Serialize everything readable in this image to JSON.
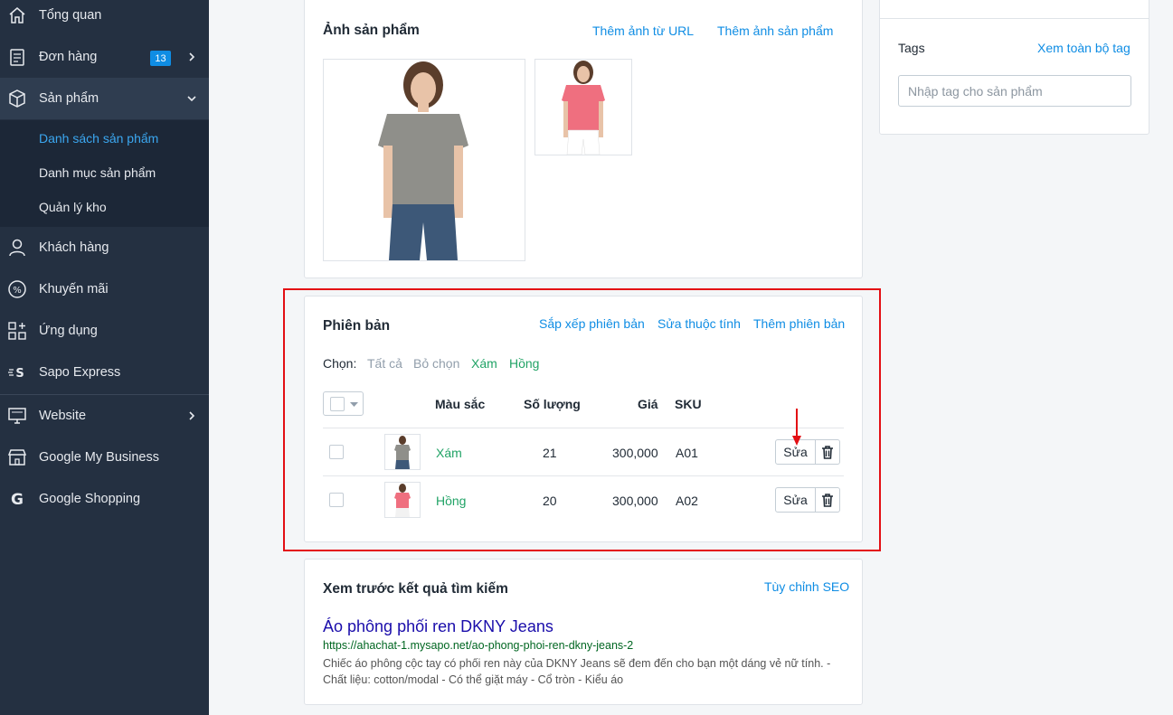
{
  "sidebar": {
    "items": [
      {
        "label": "Tổng quan",
        "icon": "home-icon"
      },
      {
        "label": "Đơn hàng",
        "icon": "orders-icon",
        "badge": "13"
      },
      {
        "label": "Sản phẩm",
        "icon": "box-icon"
      },
      {
        "label": "Khách hàng",
        "icon": "user-icon"
      },
      {
        "label": "Khuyến mãi",
        "icon": "percent-icon"
      },
      {
        "label": "Ứng dụng",
        "icon": "apps-icon"
      },
      {
        "label": "Sapo Express",
        "icon": "express-icon"
      },
      {
        "label": "Website",
        "icon": "monitor-icon"
      },
      {
        "label": "Google My Business",
        "icon": "store-icon"
      },
      {
        "label": "Google Shopping",
        "icon": "google-icon"
      }
    ],
    "submenu": [
      "Danh sách sản phẩm",
      "Danh mục sản phẩm",
      "Quản lý kho"
    ]
  },
  "images_card": {
    "title": "Ảnh sản phẩm",
    "add_from_url": "Thêm ảnh từ URL",
    "add_image": "Thêm ảnh sản phẩm"
  },
  "variants_card": {
    "title": "Phiên bản",
    "sort_link": "Sắp xếp phiên bản",
    "edit_attr_link": "Sửa thuộc tính",
    "add_link": "Thêm phiên bản",
    "chooser": {
      "label": "Chọn:",
      "all": "Tất cả",
      "none": "Bỏ chọn",
      "gray": "Xám",
      "pink": "Hồng"
    },
    "columns": [
      "Màu sắc",
      "Số lượng",
      "Giá",
      "SKU"
    ],
    "rows": [
      {
        "color": "Xám",
        "qty": "21",
        "price": "300,000",
        "sku": "A01",
        "edit": "Sửa"
      },
      {
        "color": "Hồng",
        "qty": "20",
        "price": "300,000",
        "sku": "A02",
        "edit": "Sửa"
      }
    ]
  },
  "seo_card": {
    "title": "Xem trước kết quả tìm kiếm",
    "customize": "Tùy chỉnh SEO",
    "page_title": "Áo phông phối ren DKNY Jeans",
    "url": "https://ahachat-1.mysapo.net/ao-phong-phoi-ren-dkny-jeans-2",
    "description": "Chiếc áo phông cộc tay có phối ren này của DKNY Jeans sẽ đem đến cho bạn một dáng vẻ nữ tính. - Chất liệu: cotton/modal - Có thể giặt máy - Cổ tròn - Kiểu áo"
  },
  "tags_card": {
    "title": "Tags",
    "view_all": "Xem toàn bộ tag",
    "placeholder": "Nhập tag cho sản phẩm"
  },
  "colors": {
    "sidebar": "#243041",
    "link": "#0f8de4",
    "variant_green": "#21a366",
    "highlight": "#e30f14"
  }
}
